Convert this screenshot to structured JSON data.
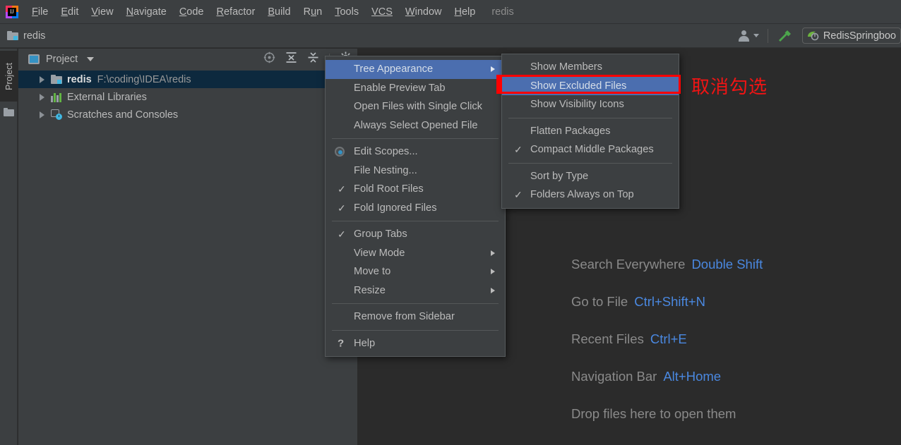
{
  "window": {
    "app_logo": "intellij-idea-logo",
    "project_name_titlebar": "redis"
  },
  "menubar": {
    "items": [
      {
        "label": "File",
        "mnemonic": "F"
      },
      {
        "label": "Edit",
        "mnemonic": "E"
      },
      {
        "label": "View",
        "mnemonic": "V"
      },
      {
        "label": "Navigate",
        "mnemonic": "N"
      },
      {
        "label": "Code",
        "mnemonic": "C"
      },
      {
        "label": "Refactor",
        "mnemonic": "R"
      },
      {
        "label": "Build",
        "mnemonic": "B"
      },
      {
        "label": "Run",
        "mnemonic": "u"
      },
      {
        "label": "Tools",
        "mnemonic": "T"
      },
      {
        "label": "VCS",
        "mnemonic": ""
      },
      {
        "label": "Window",
        "mnemonic": "W"
      },
      {
        "label": "Help",
        "mnemonic": "H"
      }
    ]
  },
  "navbar": {
    "breadcrumb": "redis",
    "folder_icon": "folder-icon",
    "user_icon": "user-icon",
    "build_icon": "hammer-build-icon",
    "run_config": {
      "icon": "spring-boot-icon",
      "label": "RedisSpringboo"
    }
  },
  "stripe": {
    "project_tab": "Project",
    "folder_icon": "folder-icon"
  },
  "tool_window": {
    "title": "Project",
    "icon": "project-view-icon",
    "dropdown_icon": "chevron-down-icon",
    "actions": [
      {
        "name": "select-opened-file-icon"
      },
      {
        "name": "expand-all-icon"
      },
      {
        "name": "collapse-all-icon"
      },
      {
        "name": "settings-gear-icon"
      }
    ],
    "tree": [
      {
        "label": "redis",
        "path": "F:\\coding\\IDEA\\redis",
        "icon": "module-folder-icon",
        "selected": true,
        "bold": true
      },
      {
        "label": "External Libraries",
        "path": "",
        "icon": "libraries-icon",
        "selected": false,
        "bold": false
      },
      {
        "label": "Scratches and Consoles",
        "path": "",
        "icon": "scratches-icon",
        "selected": false,
        "bold": false
      }
    ]
  },
  "editor_hints": [
    {
      "name": "Search Everywhere",
      "key": "Double Shift"
    },
    {
      "name": "Go to File",
      "key": "Ctrl+Shift+N"
    },
    {
      "name": "Recent Files",
      "key": "Ctrl+E"
    },
    {
      "name": "Navigation Bar",
      "key": "Alt+Home"
    },
    {
      "name": "Drop files here to open them",
      "key": ""
    }
  ],
  "annotation": {
    "text": "取消勾选",
    "color": "#f01414"
  },
  "context_menu": {
    "items": [
      {
        "label": "Tree Appearance",
        "checked": false,
        "submenu": true,
        "highlighted": true,
        "icon": ""
      },
      {
        "label": "Enable Preview Tab",
        "checked": false,
        "submenu": false,
        "highlighted": false,
        "icon": ""
      },
      {
        "label": "Open Files with Single Click",
        "checked": false,
        "submenu": false,
        "highlighted": false,
        "icon": ""
      },
      {
        "label": "Always Select Opened File",
        "checked": false,
        "submenu": false,
        "highlighted": false,
        "icon": ""
      },
      {
        "separator": true
      },
      {
        "label": "Edit Scopes...",
        "checked": false,
        "submenu": false,
        "highlighted": false,
        "icon": "radio-selected-icon"
      },
      {
        "label": "File Nesting...",
        "checked": false,
        "submenu": false,
        "highlighted": false,
        "icon": ""
      },
      {
        "label": "Fold Root Files",
        "checked": true,
        "submenu": false,
        "highlighted": false,
        "icon": ""
      },
      {
        "label": "Fold Ignored Files",
        "checked": true,
        "submenu": false,
        "highlighted": false,
        "icon": ""
      },
      {
        "separator": true
      },
      {
        "label": "Group Tabs",
        "checked": true,
        "submenu": false,
        "highlighted": false,
        "icon": ""
      },
      {
        "label": "View Mode",
        "checked": false,
        "submenu": true,
        "highlighted": false,
        "icon": ""
      },
      {
        "label": "Move to",
        "checked": false,
        "submenu": true,
        "highlighted": false,
        "icon": ""
      },
      {
        "label": "Resize",
        "checked": false,
        "submenu": true,
        "highlighted": false,
        "icon": ""
      },
      {
        "separator": true
      },
      {
        "label": "Remove from Sidebar",
        "checked": false,
        "submenu": false,
        "highlighted": false,
        "icon": ""
      },
      {
        "separator": true
      },
      {
        "label": "Help",
        "checked": false,
        "submenu": false,
        "highlighted": false,
        "icon": "question-mark-icon"
      }
    ]
  },
  "submenu": {
    "items": [
      {
        "label": "Show Members",
        "checked": false,
        "highlighted": false
      },
      {
        "label": "Show Excluded Files",
        "checked": false,
        "highlighted": true
      },
      {
        "label": "Show Visibility Icons",
        "checked": false,
        "highlighted": false
      },
      {
        "separator": true
      },
      {
        "label": "Flatten Packages",
        "checked": false,
        "highlighted": false
      },
      {
        "label": "Compact Middle Packages",
        "checked": true,
        "highlighted": false
      },
      {
        "separator": true
      },
      {
        "label": "Sort by Type",
        "checked": false,
        "highlighted": false
      },
      {
        "label": "Folders Always on Top",
        "checked": true,
        "highlighted": false
      }
    ]
  },
  "colors": {
    "panel_bg": "#3c3f41",
    "editor_bg": "#2b2b2b",
    "highlight": "#4b6eaf",
    "tree_selected": "#0d293e",
    "hint_key": "#4a88e0",
    "annotation_red": "#f01414",
    "redbox": "#ff0000"
  }
}
